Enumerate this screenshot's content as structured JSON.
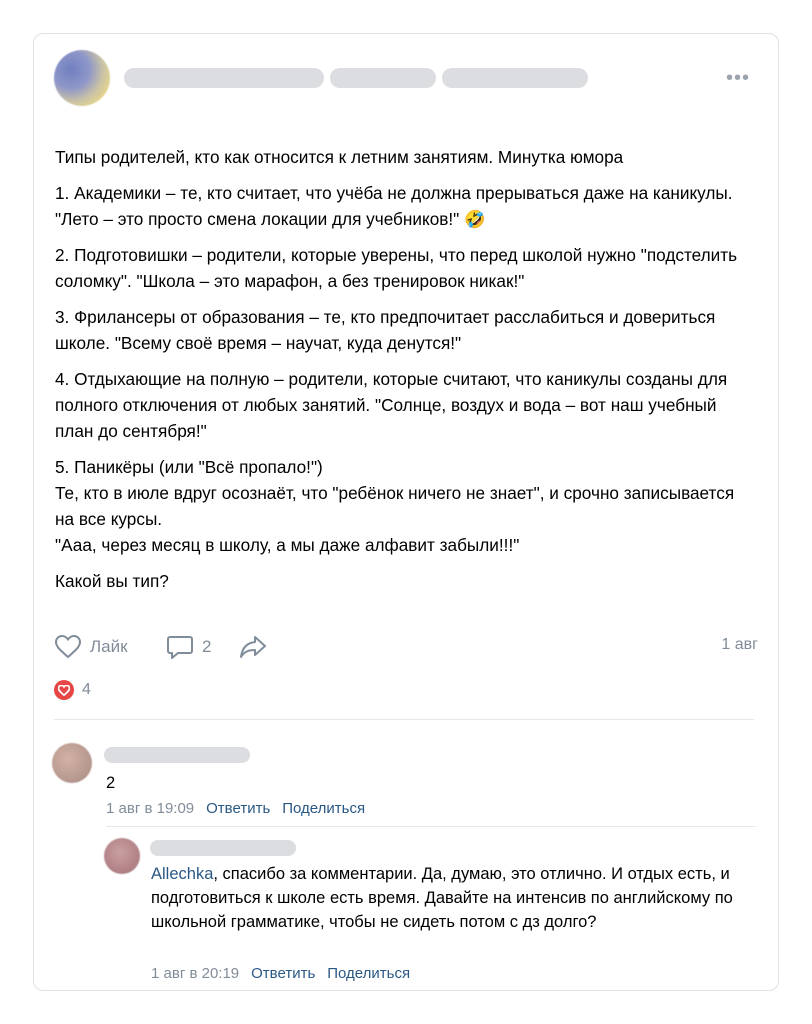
{
  "post": {
    "paragraphs": [
      "Типы родителей, кто как относится к летним занятиям. Минутка юмора",
      "1. Академики – те, кто считает, что учёба не должна прерываться даже на каникулы. \"Лето – это просто смена локации для учебников!\" 🤣",
      "2. Подготовишки – родители, которые уверены, что перед школой нужно \"подстелить соломку\". \"Школа – это марафон, а без тренировок никак!\"",
      "3. Фрилансеры от образования – те, кто предпочитает расслабиться и довериться школе. \"Всему своё время – научат, куда денутся!\"",
      "4. Отдыхающие на полную – родители, которые считают, что каникулы созданы для полного отключения от любых занятий. \"Солнце, воздух и вода – вот наш учебный план до сентября!\"",
      "5. Паникёры (или \"Всё пропало!\")\nТе, кто в июле вдруг осознаёт, что \"ребёнок ничего не знает\", и срочно записывается на все курсы.\n\"Ааа, через месяц в школу, а мы даже алфавит забыли!!!\"",
      "Какой вы тип?"
    ],
    "like_label": "Лайк",
    "comments_count": "2",
    "date": "1 авг",
    "reactions_count": "4",
    "icons": {
      "more": "more-dots-icon",
      "like": "heart-outline-icon",
      "comment": "comment-icon",
      "share": "share-arrow-icon",
      "reaction": "heart-filled-icon"
    }
  },
  "comments": [
    {
      "text": "2",
      "time": "1 авг в 19:09",
      "reply_label": "Ответить",
      "share_label": "Поделиться"
    },
    {
      "mention": "Allechka",
      "text": ", спасибо за комментарии. Да, думаю, это отлично. И отдых есть, и подготовиться к школе есть время. Давайте на интенсив по английскому по школьной грамматике, чтобы не сидеть потом с дз долго?",
      "time": "1 авг в 20:19",
      "reply_label": "Ответить",
      "share_label": "Поделиться"
    }
  ],
  "colors": {
    "link": "#2a5885",
    "muted": "#818c99",
    "reaction": "#e64646",
    "placeholder": "#dcdde0"
  }
}
